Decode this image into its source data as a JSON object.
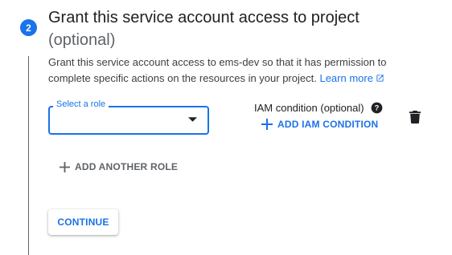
{
  "step": {
    "number": "2",
    "title": "Grant this service account access to project",
    "optional": "(optional)",
    "description": "Grant this service account access to ems-dev so that it has permission to complete specific actions on the resources in your project.",
    "learn_more": "Learn more"
  },
  "role": {
    "label": "Select a role",
    "value": ""
  },
  "iam": {
    "label": "IAM condition (optional)",
    "add_button": "ADD IAM CONDITION"
  },
  "add_another_role": "ADD ANOTHER ROLE",
  "continue_button": "CONTINUE",
  "colors": {
    "accent": "#1a73e8",
    "muted": "#5f6368"
  },
  "icons": [
    "help-icon",
    "trash-icon",
    "plus-icon",
    "external-link-icon",
    "dropdown-caret-icon"
  ]
}
